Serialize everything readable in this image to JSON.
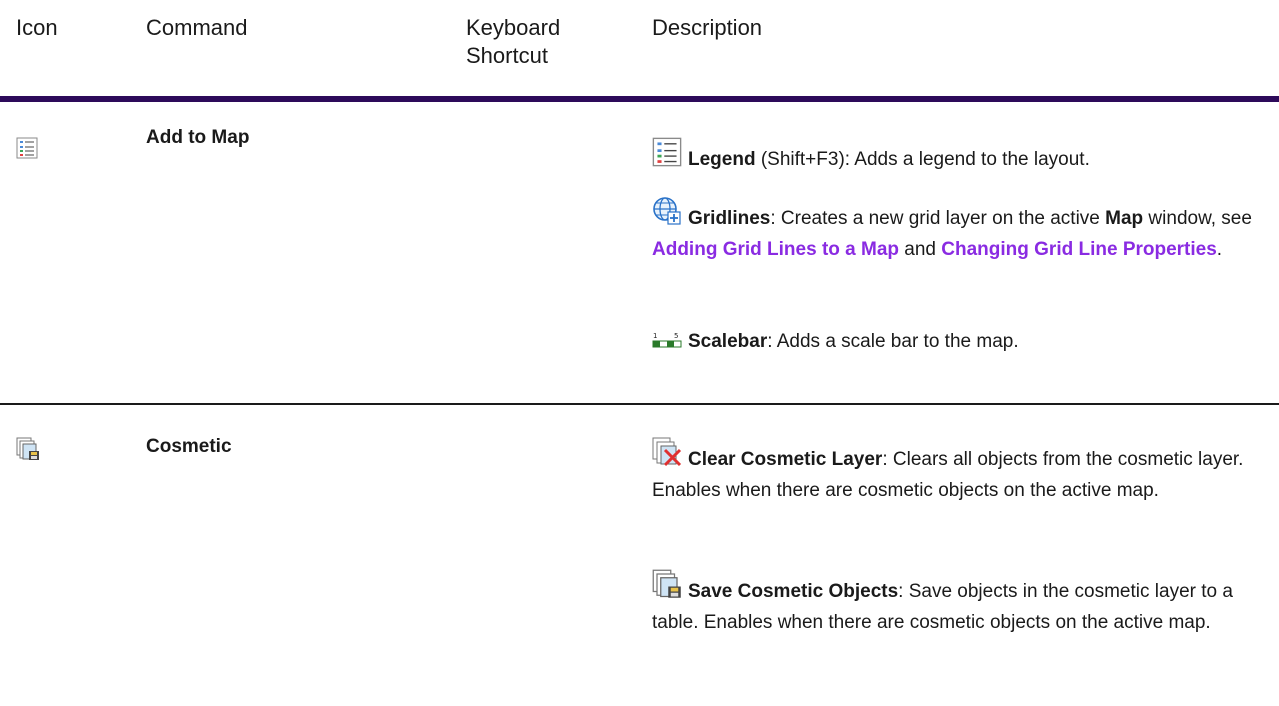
{
  "table": {
    "headers": {
      "icon": "Icon",
      "command": "Command",
      "keyboard": "Keyboard Shortcut",
      "description": "Description"
    },
    "rows": [
      {
        "icon": "legend-icon",
        "command": "Add to Map",
        "items": [
          {
            "icon": "legend-icon",
            "name": "Legend",
            "text": " (Shift+F3): Adds a legend to the layout."
          },
          {
            "icon": "gridlines-icon",
            "name": "Gridlines",
            "text_a": ": Creates a new grid layer on the active ",
            "bold_map": "Map",
            "text_b": " window, see ",
            "link1": "Adding Grid Lines to a Map",
            "text_c": " and ",
            "link2": "Changing Grid Line Properties",
            "text_d": "."
          },
          {
            "icon": "scalebar-icon",
            "name": "Scalebar",
            "text": ": Adds a scale bar to the map."
          }
        ]
      },
      {
        "icon": "save-cosmetic-icon",
        "command": "Cosmetic",
        "items": [
          {
            "icon": "clear-cosmetic-icon",
            "name": "Clear Cosmetic Layer",
            "text": ": Clears all objects from the cosmetic layer. Enables when there are cosmetic objects on the active map."
          },
          {
            "icon": "save-cosmetic-icon",
            "name": "Save Cosmetic Objects",
            "text": ": Save objects in the cosmetic layer to a table. Enables when there are cosmetic objects on the active map."
          }
        ]
      }
    ]
  },
  "colors": {
    "header_rule": "#2d0a5a",
    "link": "#8a2be2"
  }
}
